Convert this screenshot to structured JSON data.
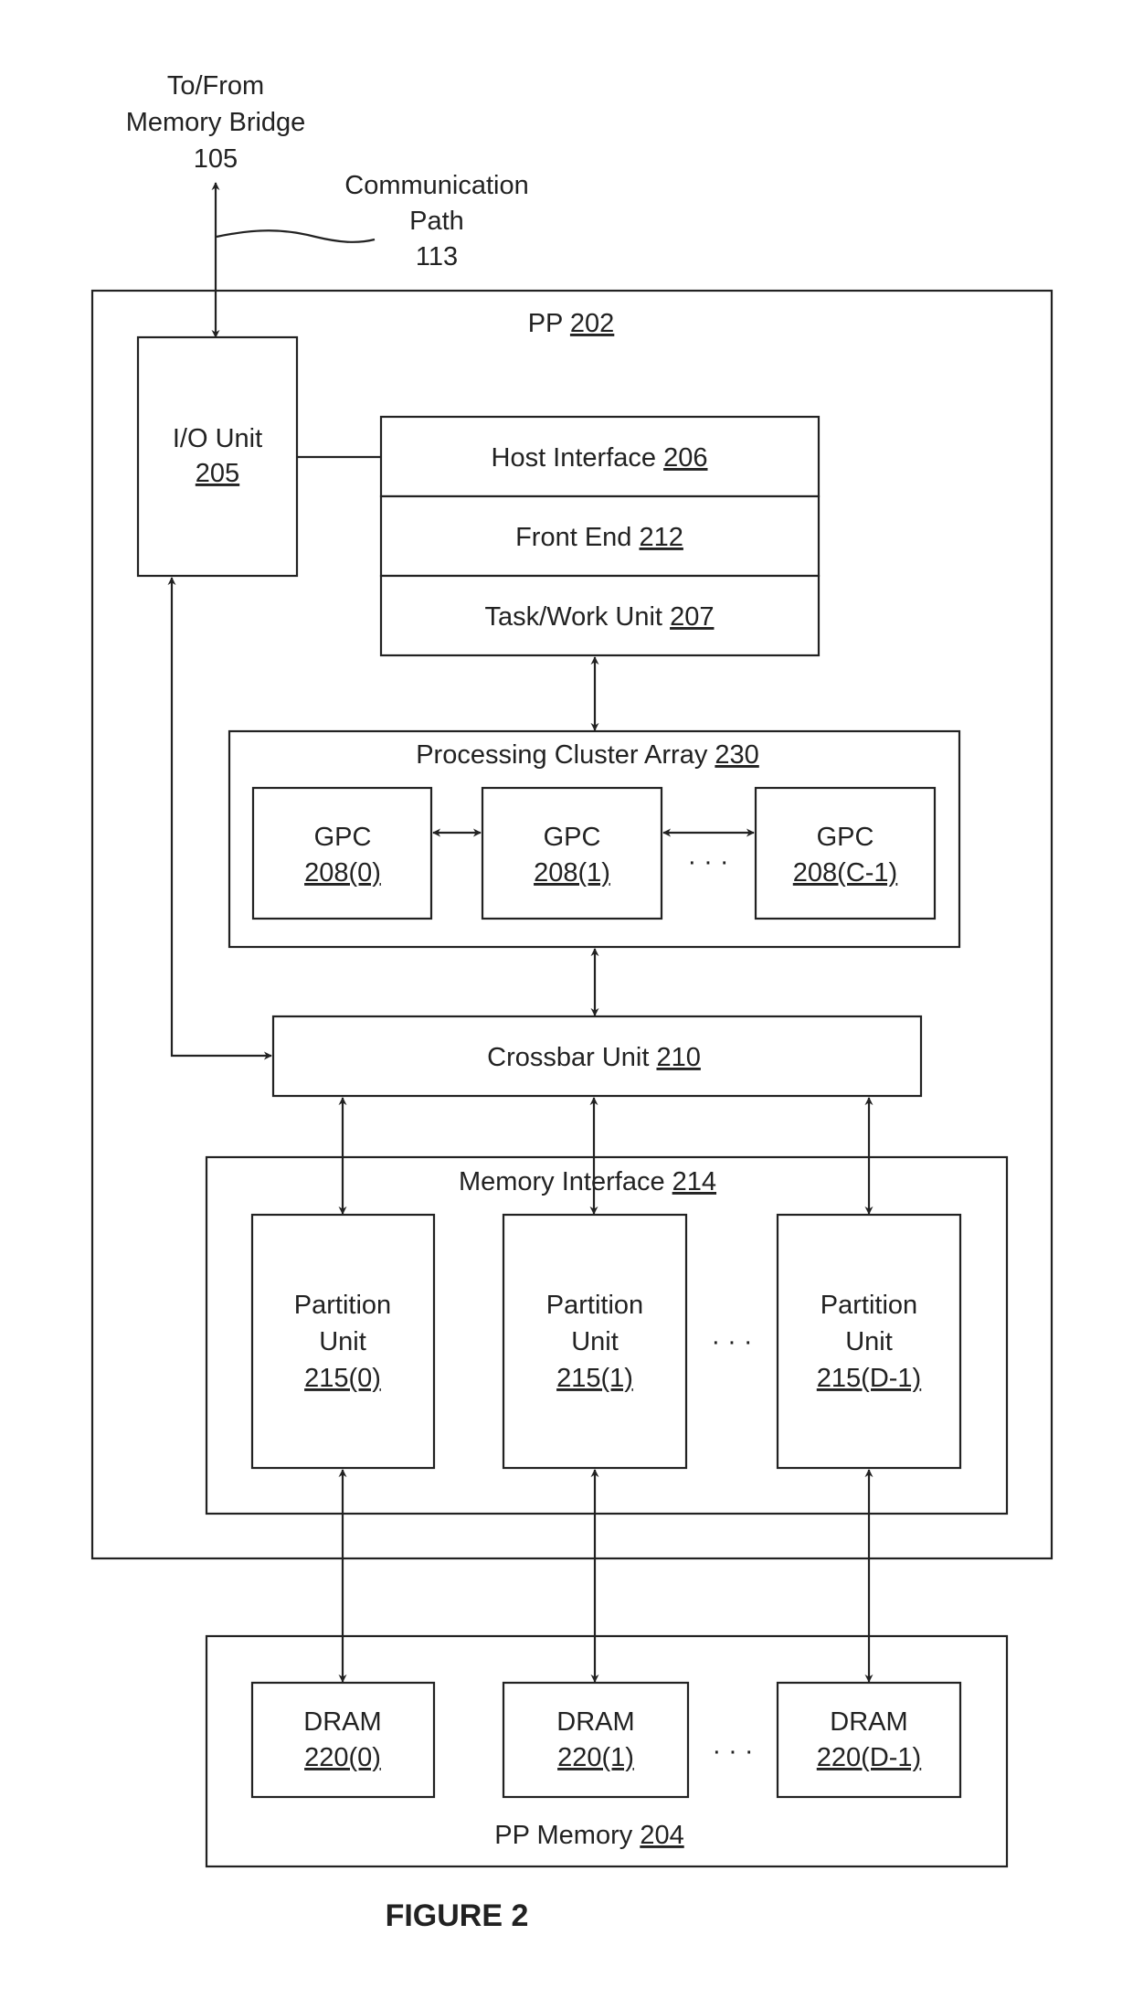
{
  "external": {
    "memory_bridge": [
      "To/From",
      "Memory Bridge",
      "105"
    ],
    "comm_path": [
      "Communication",
      "Path",
      "113"
    ]
  },
  "pp": {
    "label": "PP ",
    "ref": "202"
  },
  "io_unit": {
    "label": "I/O Unit",
    "ref": "205"
  },
  "host_stack": [
    {
      "label": "Host Interface ",
      "ref": "206"
    },
    {
      "label": "Front End ",
      "ref": "212"
    },
    {
      "label": "Task/Work Unit ",
      "ref": "207"
    }
  ],
  "pca": {
    "label": "Processing Cluster Array ",
    "ref": "230",
    "gpcs": [
      {
        "label": "GPC",
        "ref": "208(0)"
      },
      {
        "label": "GPC",
        "ref": "208(1)"
      },
      {
        "label": "GPC",
        "ref": "208(C-1)"
      }
    ],
    "ellipsis": "· · ·"
  },
  "crossbar": {
    "label": "Crossbar Unit ",
    "ref": "210"
  },
  "memory_interface": {
    "label": "Memory Interface ",
    "ref": "214",
    "partitions": [
      {
        "line1": "Partition",
        "line2": "Unit",
        "ref": "215(0)"
      },
      {
        "line1": "Partition",
        "line2": "Unit",
        "ref": "215(1)"
      },
      {
        "line1": "Partition",
        "line2": "Unit",
        "ref": "215(D-1)"
      }
    ],
    "ellipsis": "· · ·"
  },
  "pp_memory": {
    "label": "PP Memory ",
    "ref": "204",
    "drams": [
      {
        "label": "DRAM",
        "ref": "220(0)"
      },
      {
        "label": "DRAM",
        "ref": "220(1)"
      },
      {
        "label": "DRAM",
        "ref": "220(D-1)"
      }
    ],
    "ellipsis": "· · ·"
  },
  "figure_caption": "FIGURE 2"
}
